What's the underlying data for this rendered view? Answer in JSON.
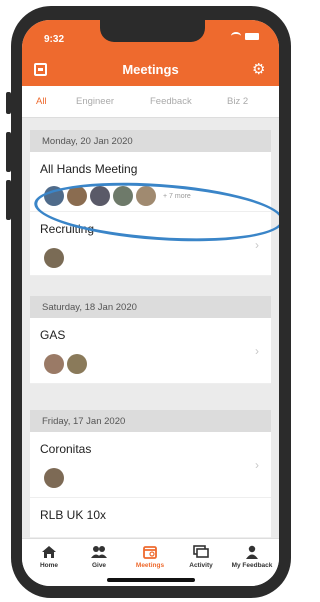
{
  "status": {
    "time": "9:32"
  },
  "header": {
    "title": "Meetings"
  },
  "tabs": [
    "All",
    "Engineer",
    "Feedback",
    "Biz 2"
  ],
  "groups": [
    {
      "date": "Monday, 20 Jan 2020",
      "meetings": [
        {
          "title": "All Hands Meeting",
          "more": "+ 7 more"
        },
        {
          "title": "Recruiting"
        }
      ]
    },
    {
      "date": "Saturday, 18 Jan 2020",
      "meetings": [
        {
          "title": "GAS"
        }
      ]
    },
    {
      "date": "Friday, 17 Jan 2020",
      "meetings": [
        {
          "title": "Coronitas"
        },
        {
          "title": "RLB UK 10x"
        }
      ]
    }
  ],
  "nav": [
    "Home",
    "Give",
    "Meetings",
    "Activity",
    "My Feedback"
  ],
  "colors": {
    "accent": "#ee6a2e",
    "annotation": "#3a85c8"
  }
}
